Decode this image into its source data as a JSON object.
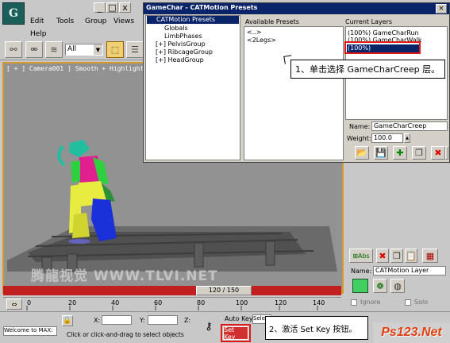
{
  "menu": {
    "items": [
      "Edit",
      "Tools",
      "Group",
      "Views",
      "Help"
    ],
    "win_min": "_",
    "win_max": "□",
    "win_close": "x"
  },
  "toolbar": {
    "filter_value": "All"
  },
  "viewport": {
    "label": "[ + ] Camera001 ] Smooth + Highlights ]",
    "watermark": "腾龍视觉 WWW.TLVI.NET"
  },
  "dialog": {
    "title": "GameChar - CATMotion Presets",
    "close": "×",
    "tree": [
      {
        "label": "CATMotion Presets",
        "indent": 0,
        "selected": true
      },
      {
        "label": "Globals",
        "indent": 2
      },
      {
        "label": "LimbPhases",
        "indent": 2
      },
      {
        "label": "[+] PelvisGroup",
        "indent": 1
      },
      {
        "label": "[+] RibcageGroup",
        "indent": 1
      },
      {
        "label": "[+] HeadGroup",
        "indent": 1
      }
    ],
    "available_header": "Available Presets",
    "available": [
      "<..>",
      "<2Legs>"
    ],
    "current_header": "Current Layers",
    "layers": [
      {
        "label": "(100%) GameCharRun",
        "selected": false
      },
      {
        "label": "(100%) GameCharWalk",
        "selected": false
      },
      {
        "label": "(100%) GameCharCreep",
        "selected": true
      }
    ],
    "name_label": "Name:",
    "name_value": "GameCharCreep",
    "weight_label": "Weight:",
    "weight_value": "100.0"
  },
  "callout1": "1、单击选择 GameCharCreep 层。",
  "callout2": "2、激活 Set Key 按钮。",
  "right_panel": {
    "name_label": "Name:",
    "name_value": "CATMotion Layer",
    "ignore": "Ignore",
    "solo": "Solo"
  },
  "timeline": {
    "frame_label": "120 / 150",
    "ticks": [
      "0",
      "20",
      "40",
      "60",
      "80",
      "100",
      "120",
      "140"
    ]
  },
  "status": {
    "welcome": "Welcome to MAX:",
    "prompt": "Click or click-and-drag to select objects",
    "x_label": "X:",
    "y_label": "Y:",
    "z_label": "Z:",
    "auto_key": "Auto Key",
    "set_key": "Set Key",
    "sel_value": "Sele"
  },
  "site_logo": "Ps123.Net"
}
